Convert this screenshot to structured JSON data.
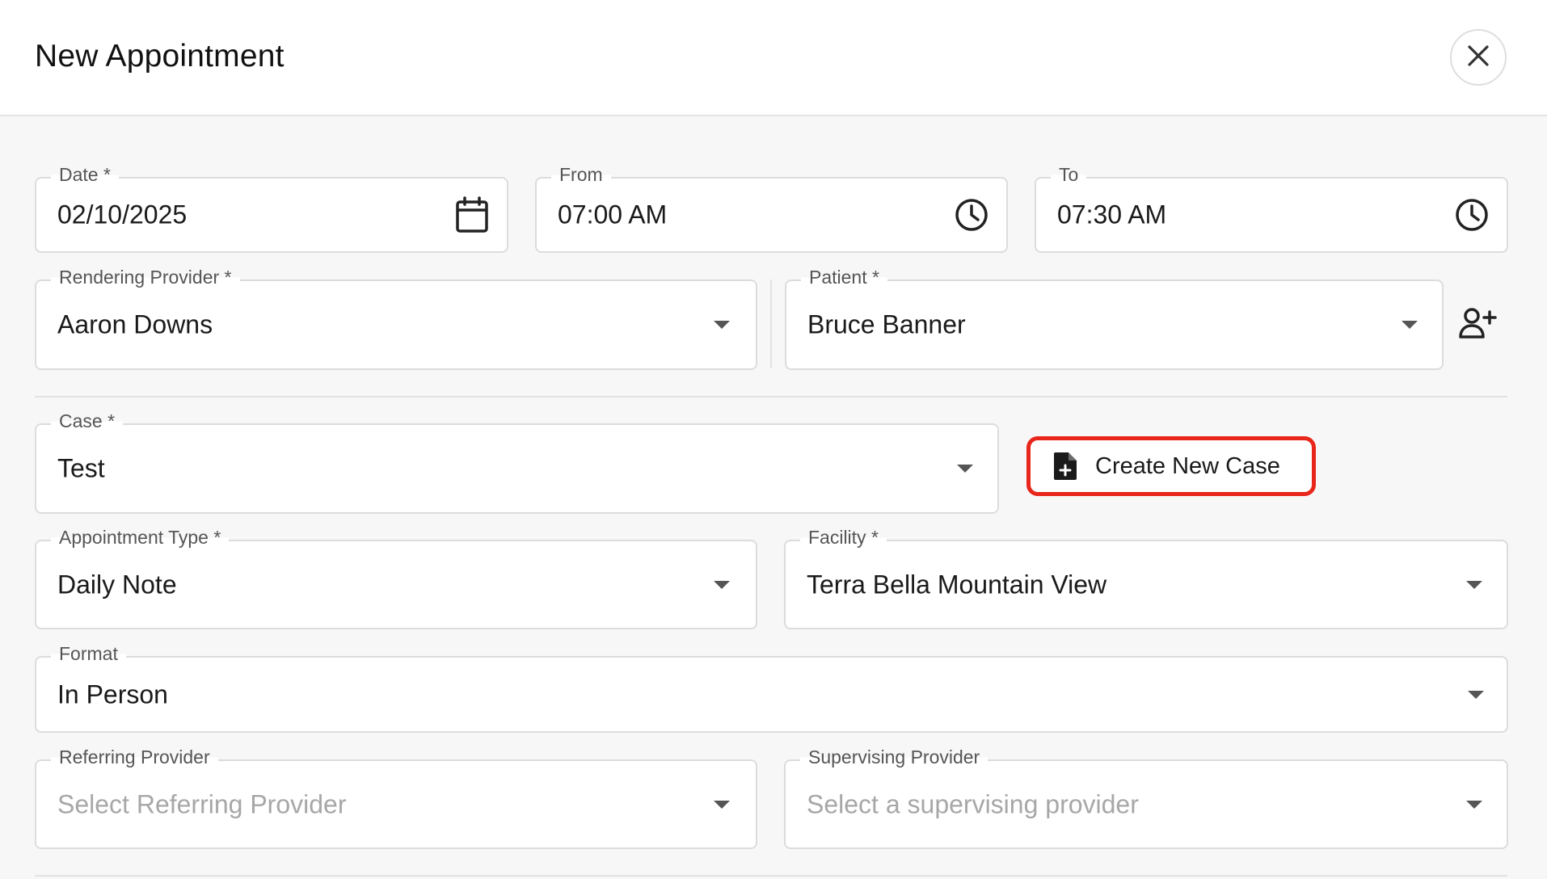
{
  "dialog": {
    "title": "New Appointment",
    "close_icon": "close-icon"
  },
  "fields": {
    "date": {
      "label": "Date *",
      "value": "02/10/2025",
      "icon": "calendar-icon"
    },
    "from": {
      "label": "From",
      "value": "07:00 AM",
      "icon": "clock-icon"
    },
    "to": {
      "label": "To",
      "value": "07:30 AM",
      "icon": "clock-icon"
    },
    "rendering_provider": {
      "label": "Rendering Provider *",
      "value": "Aaron Downs"
    },
    "patient": {
      "label": "Patient *",
      "value": "Bruce Banner",
      "action_icon": "add-user-icon"
    },
    "case": {
      "label": "Case *",
      "value": "Test"
    },
    "appointment_type": {
      "label": "Appointment Type *",
      "value": "Daily Note"
    },
    "facility": {
      "label": "Facility *",
      "value": "Terra Bella Mountain View"
    },
    "format": {
      "label": "Format",
      "value": "In Person"
    },
    "referring_provider": {
      "label": "Referring Provider",
      "placeholder": "Select Referring Provider"
    },
    "supervising_provider": {
      "label": "Supervising Provider",
      "placeholder": "Select a supervising provider"
    }
  },
  "actions": {
    "create_new_case": {
      "label": "Create New Case",
      "icon": "file-add-icon"
    }
  },
  "colors": {
    "highlight": "#e8261b",
    "border": "#dcdcdc",
    "placeholder": "#a7a7a7",
    "background": "#f7f7f7"
  }
}
